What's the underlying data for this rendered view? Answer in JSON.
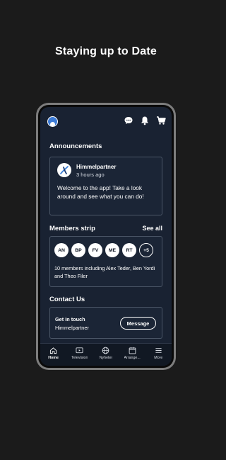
{
  "headline": "Staying up to Date",
  "announcements": {
    "title": "Announcements",
    "item": {
      "author": "Himmelpartner",
      "time": "3 hours ago",
      "body": "Welcome to the app! Take a look around and see what you can do!"
    }
  },
  "members": {
    "title": "Members strip",
    "see_all": "See all",
    "badges": [
      "AN",
      "BP",
      "FV",
      "ME",
      "RT"
    ],
    "more": "+5",
    "summary": "10 members including Alex Teder, Ben Yordi and Theo Filer"
  },
  "contact": {
    "title": "Contact Us",
    "card_title": "Get in touch",
    "card_sub": "Himmelpartner",
    "button": "Message"
  },
  "tabs": [
    {
      "label": "Home",
      "icon": "home-icon",
      "active": true
    },
    {
      "label": "Television",
      "icon": "tv-icon",
      "active": false
    },
    {
      "label": "Nyheter",
      "icon": "globe-icon",
      "active": false
    },
    {
      "label": "Arrange...",
      "icon": "calendar-icon",
      "active": false
    },
    {
      "label": "More",
      "icon": "menu-icon",
      "active": false
    }
  ],
  "colors": {
    "background": "#1b1b1b",
    "screen": "#192232",
    "card": "#1b2536",
    "logo_accent": "#3b7fd8"
  }
}
